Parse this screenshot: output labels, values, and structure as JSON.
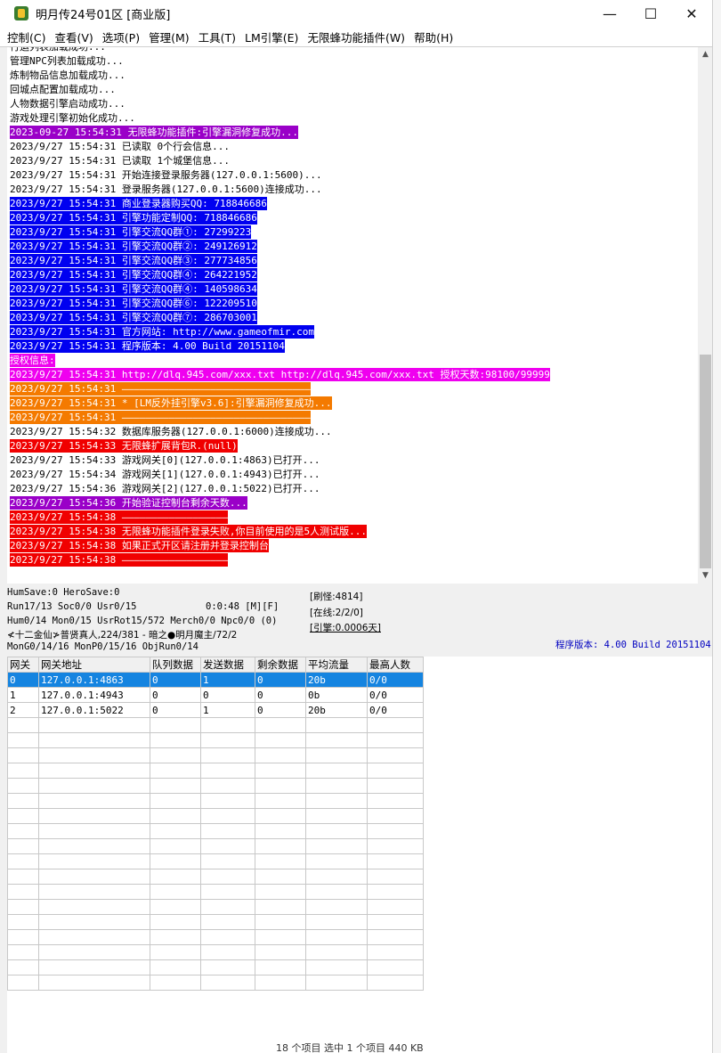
{
  "window": {
    "title": "明月传24号01区 [商业版]",
    "min": "—",
    "max": "☐",
    "close": "✕"
  },
  "menu": [
    "控制(C)",
    "查看(V)",
    "选项(P)",
    "管理(M)",
    "工具(T)",
    "LM引擎(E)",
    "无限蜂功能插件(W)",
    "帮助(H)"
  ],
  "log": [
    {
      "text": "行运列表加载成功...",
      "style": "normal"
    },
    {
      "text": "管理NPC列表加载成功...",
      "style": "normal"
    },
    {
      "text": "炼制物品信息加载成功...",
      "style": "normal"
    },
    {
      "text": "回城点配置加载成功...",
      "style": "normal"
    },
    {
      "text": "人物数据引擎启动成功...",
      "style": "normal"
    },
    {
      "text": "游戏处理引擎初始化成功...",
      "style": "normal"
    },
    {
      "text": "2023-09-27 15:54:31 无限蜂功能插件:引擎漏洞修复成功...",
      "style": "purple"
    },
    {
      "text": "2023/9/27 15:54:31 已读取 0个行会信息...",
      "style": "normal"
    },
    {
      "text": "2023/9/27 15:54:31 已读取 1个城堡信息...",
      "style": "normal"
    },
    {
      "text": "2023/9/27 15:54:31 开始连接登录服务器(127.0.0.1:5600)...",
      "style": "normal"
    },
    {
      "text": "2023/9/27 15:54:31 登录服务器(127.0.0.1:5600)连接成功...",
      "style": "normal"
    },
    {
      "text": "2023/9/27 15:54:31 商业登录器购买QQ: 718846686",
      "style": "blue"
    },
    {
      "text": "2023/9/27 15:54:31 引擎功能定制QQ: 718846686",
      "style": "blue"
    },
    {
      "text": "2023/9/27 15:54:31 引擎交流QQ群①: 27299223",
      "style": "blue"
    },
    {
      "text": "2023/9/27 15:54:31 引擎交流QQ群②: 249126912",
      "style": "blue"
    },
    {
      "text": "2023/9/27 15:54:31 引擎交流QQ群③: 277734856",
      "style": "blue"
    },
    {
      "text": "2023/9/27 15:54:31 引擎交流QQ群④: 264221952",
      "style": "blue"
    },
    {
      "text": "2023/9/27 15:54:31 引擎交流QQ群④: 140598634",
      "style": "blue"
    },
    {
      "text": "2023/9/27 15:54:31 引擎交流QQ群⑥: 122209510",
      "style": "blue"
    },
    {
      "text": "2023/9/27 15:54:31 引擎交流QQ群⑦: 286703001",
      "style": "blue"
    },
    {
      "text": "2023/9/27 15:54:31 官方网站: http://www.gameofmir.com",
      "style": "blue"
    },
    {
      "text": "2023/9/27 15:54:31 程序版本: 4.00 Build 20151104",
      "style": "blue"
    },
    {
      "text": "授权信息:",
      "style": "magenta"
    },
    {
      "text": "2023/9/27 15:54:31 http://dlq.945.com/xxx.txt http://dlq.945.com/xxx.txt 授权天数:98100/99999",
      "style": "magenta"
    },
    {
      "text": "2023/9/27 15:54:31 ————————————————————————————————",
      "style": "orange"
    },
    {
      "text": "2023/9/27 15:54:31 * [LM反外挂引擎v3.6]:引擎漏洞修复成功...",
      "style": "orange"
    },
    {
      "text": "2023/9/27 15:54:31 ————————————————————————————————",
      "style": "orange"
    },
    {
      "text": "2023/9/27 15:54:32 数据库服务器(127.0.0.1:6000)连接成功...",
      "style": "normal"
    },
    {
      "text": "2023/9/27 15:54:33 无限蜂扩展背包R.(null)",
      "style": "red"
    },
    {
      "text": "2023/9/27 15:54:33 游戏网关[0](127.0.0.1:4863)已打开...",
      "style": "normal"
    },
    {
      "text": "2023/9/27 15:54:34 游戏网关[1](127.0.0.1:4943)已打开...",
      "style": "normal"
    },
    {
      "text": "2023/9/27 15:54:36 游戏网关[2](127.0.0.1:5022)已打开...",
      "style": "normal"
    },
    {
      "text": "2023/9/27 15:54:36 开始验证控制台剩余天数...",
      "style": "purple"
    },
    {
      "text": "2023/9/27 15:54:38 ——————————————————",
      "style": "red"
    },
    {
      "text": "2023/9/27 15:54:38 无限蜂功能插件登录失败,你目前使用的是5人测试版...",
      "style": "red"
    },
    {
      "text": "2023/9/27 15:54:38 如果正式开区请注册并登录控制台",
      "style": "red"
    },
    {
      "text": "2023/9/27 15:54:38 ——————————————————",
      "style": "red"
    }
  ],
  "status": {
    "line1": "HumSave:0 HeroSave:0",
    "line2": "Run17/13 Soc0/0 Usr0/15",
    "time": "0:0:48 [M][F]",
    "line3": "Hum0/14 Mon0/15 UsrRot15/572 Merch0/0 Npc0/0 (0)",
    "line4": "≮十二金仙≯普贤真人,224/381 - 暗之●明月魔主/72/2",
    "line5": "MonG0/14/16 MonP0/15/16 ObjRun0/14",
    "refresh": "[刷怪:4814]",
    "online": "[在线:2/2/0]",
    "engine": "[引擎:0.0006天]",
    "version": "程序版本: 4.00 Build 20151104"
  },
  "grid": {
    "columns": [
      "网关",
      "网关地址",
      "队列数据",
      "发送数据",
      "剩余数据",
      "平均流量",
      "最高人数"
    ],
    "rows": [
      [
        "0",
        "127.0.0.1:4863",
        "0",
        "1",
        "0",
        "20b",
        "0/0"
      ],
      [
        "1",
        "127.0.0.1:4943",
        "0",
        "0",
        "0",
        "0b",
        "0/0"
      ],
      [
        "2",
        "127.0.0.1:5022",
        "0",
        "1",
        "0",
        "20b",
        "0/0"
      ]
    ],
    "selected_row": 0
  },
  "behind_text": "18 个项目    选中 1 个项目 440 KB"
}
